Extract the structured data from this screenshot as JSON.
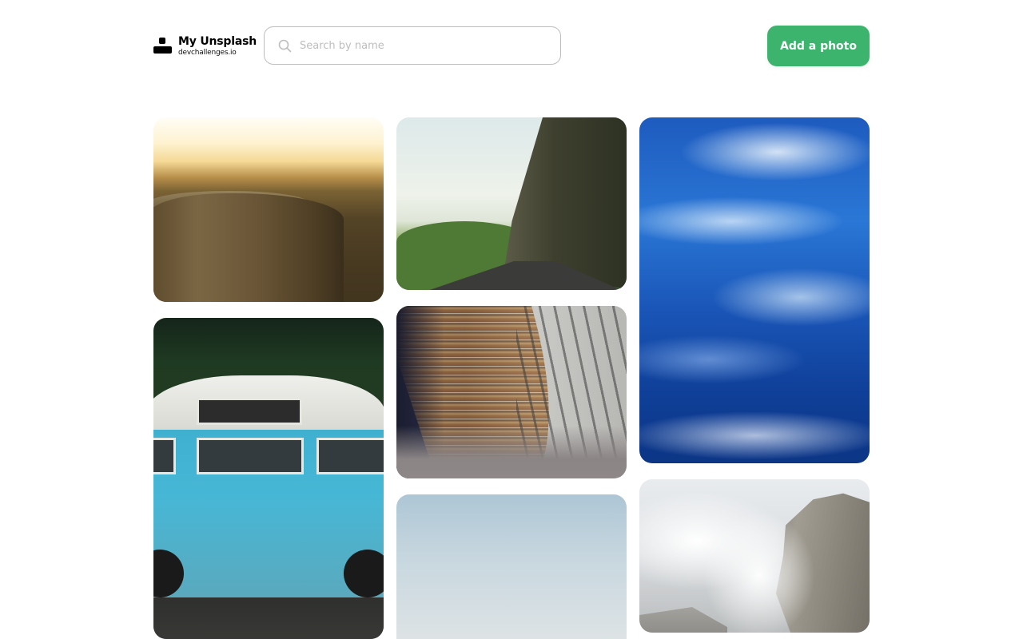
{
  "header": {
    "logo": {
      "title": "My Unsplash",
      "subtitle": "devchallenges.io",
      "icon": "user-icon"
    },
    "search": {
      "placeholder": "Search by name",
      "value": "",
      "icon": "search-icon"
    },
    "add_button_label": "Add a photo"
  },
  "colors": {
    "accent": "#3DB46D",
    "border": "#BDBDBD",
    "placeholder": "#BDBDBD",
    "text": "#000000"
  },
  "gallery": {
    "columns": [
      {
        "photos": [
          {
            "subject": "tree stump at sunset"
          },
          {
            "subject": "blue camper van"
          }
        ]
      },
      {
        "photos": [
          {
            "subject": "road through cliff tunnel"
          },
          {
            "subject": "curved library bookshelves"
          },
          {
            "subject": "pale blue sky"
          }
        ]
      },
      {
        "photos": [
          {
            "subject": "ocean waves"
          },
          {
            "subject": "misty mountain rock"
          }
        ]
      }
    ]
  }
}
